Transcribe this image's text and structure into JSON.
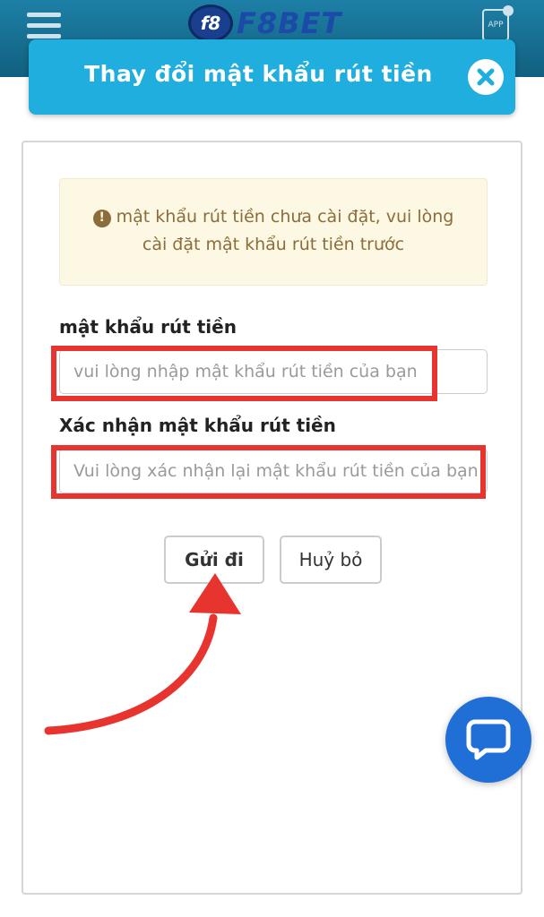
{
  "header": {
    "logo_badge": "f8",
    "logo_text": "F8BET",
    "app_label": "APP"
  },
  "modal": {
    "title": "Thay đổi mật khẩu rút tiền",
    "alert_icon": "!",
    "alert_line1": "mật khẩu rút tiền chưa cài đặt, vui lòng",
    "alert_line2": "cài đặt mật khẩu rút tiền trước",
    "password_label": "mật khẩu rút tiền",
    "password_placeholder": "vui lòng nhập mật khẩu rút tiền của bạn",
    "confirm_label": "Xác nhận mật khẩu rút tiền",
    "confirm_placeholder": "Vui lòng xác nhận lại mật khẩu rút tiền của bạn",
    "submit_label": "Gửi đi",
    "cancel_label": "Huỷ bỏ"
  },
  "colors": {
    "header_bg": "#12607f",
    "modal_header": "#20aede",
    "alert_bg": "#fcf8e3",
    "highlight": "#e8342f",
    "chat_button": "#1f6fd6"
  },
  "icons": [
    "menu-icon",
    "app-icon",
    "close-icon",
    "alert-icon",
    "chat-icon",
    "arrow-annotation"
  ]
}
